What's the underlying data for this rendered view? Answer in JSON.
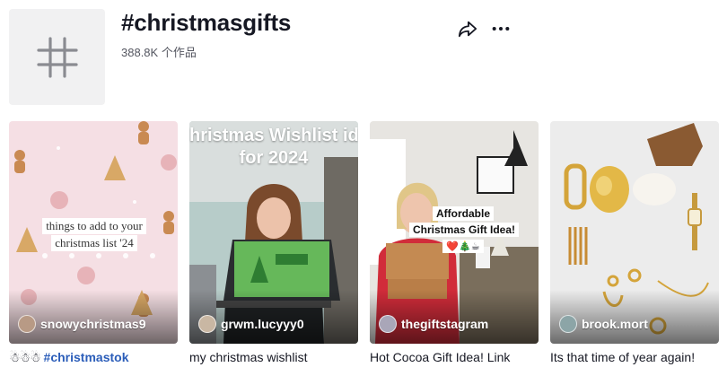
{
  "header": {
    "title": "#christmasgifts",
    "stats": "388.8K 个作品"
  },
  "icons": {
    "tag": "hashtag-icon",
    "share": "share-arrow-icon",
    "more": "more-dots-icon"
  },
  "videos": [
    {
      "author": "snowychristmas9",
      "overlay": [
        "things to add to your",
        "christmas list '24"
      ],
      "caption_emoji": "☃☃☃",
      "caption_tag": "#christmastok",
      "caption": ""
    },
    {
      "author": "grwm.lucyyy0",
      "overlay": [
        "hristmas Wishlist ide",
        "for 2024"
      ],
      "caption": "my christmas wishlist"
    },
    {
      "author": "thegiftstagram",
      "overlay": [
        "Affordable",
        "Christmas Gift Idea!",
        "❤️🎄☕"
      ],
      "caption": "Hot Cocoa Gift Idea! Link"
    },
    {
      "author": "brook.mort",
      "overlay": [],
      "caption": "Its that time of year again!"
    }
  ]
}
